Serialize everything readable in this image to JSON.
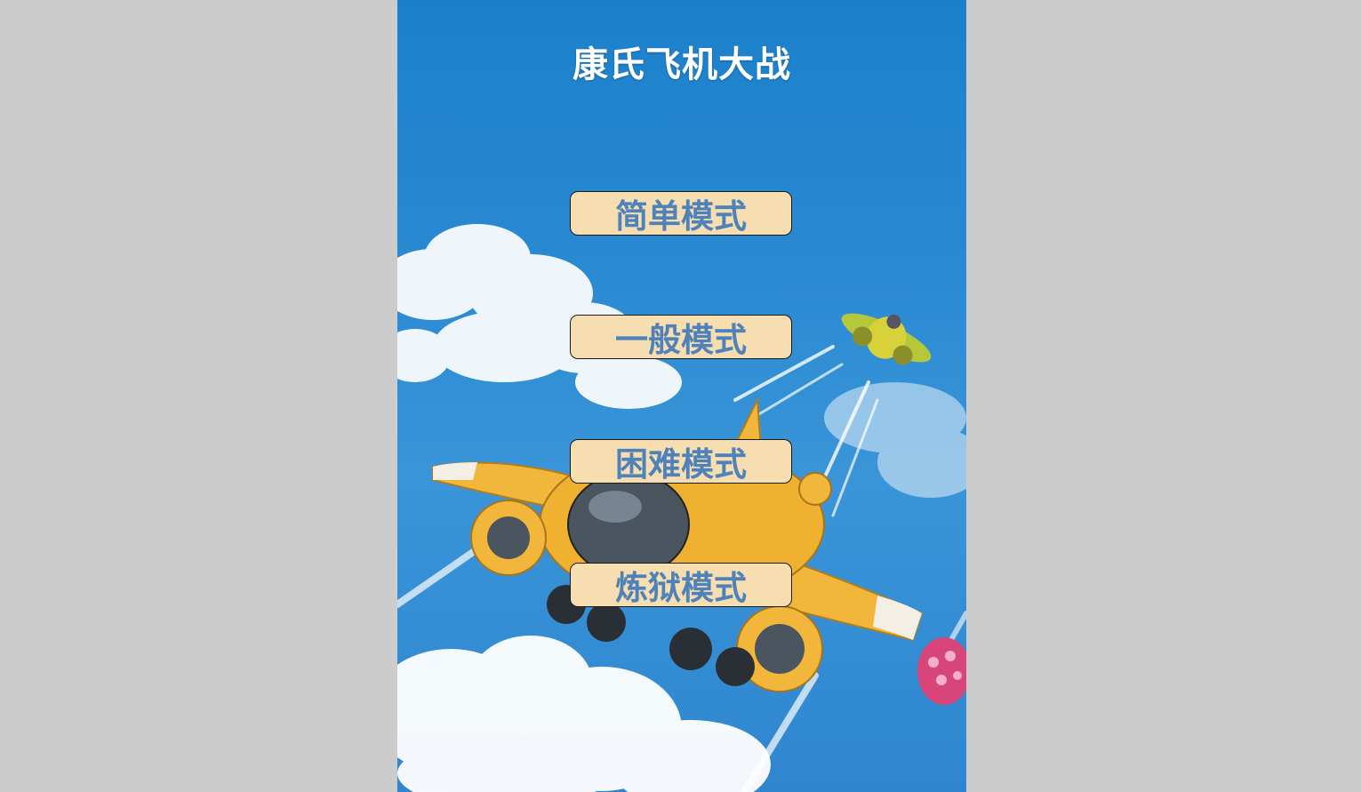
{
  "game": {
    "title": "康氏飞机大战"
  },
  "menu": {
    "buttons": [
      {
        "label": "简单模式"
      },
      {
        "label": "一般模式"
      },
      {
        "label": "困难模式"
      },
      {
        "label": "炼狱模式"
      }
    ]
  },
  "colors": {
    "page_background": "#cccccc",
    "sky": "#1b80cb",
    "button_fill": "#f6deb1",
    "button_text": "#4f82b9",
    "title_text": "#ffffff",
    "player_plane": "#f2b63a",
    "enemy_plane": "#b6c83a"
  },
  "icons": [
    "player-plane-icon",
    "enemy-plane-icon",
    "pink-enemy-icon",
    "cloud-icon",
    "bullet-streak-icon"
  ]
}
